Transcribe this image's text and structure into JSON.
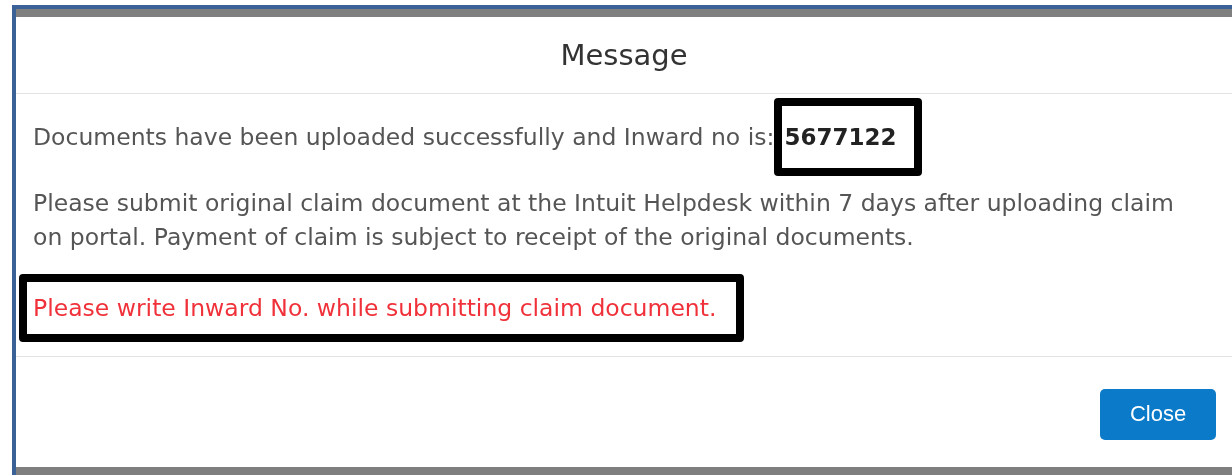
{
  "dialog": {
    "title": "Message",
    "messages": [
      {
        "kind": "info",
        "text": "Documents have been uploaded successfully and Inward no is:",
        "value": "5677122",
        "highlighted": true
      },
      {
        "kind": "info",
        "text": "Please submit original claim document at the Intuit Helpdesk within 7 days after uploading claim on portal. Payment of claim is subject to receipt of the original documents.",
        "highlighted": false
      },
      {
        "kind": "warning",
        "text": "Please write Inward No. while submitting claim document.",
        "highlighted": true
      }
    ],
    "buttons": [
      {
        "label": "Close",
        "kind": "primary"
      }
    ]
  }
}
